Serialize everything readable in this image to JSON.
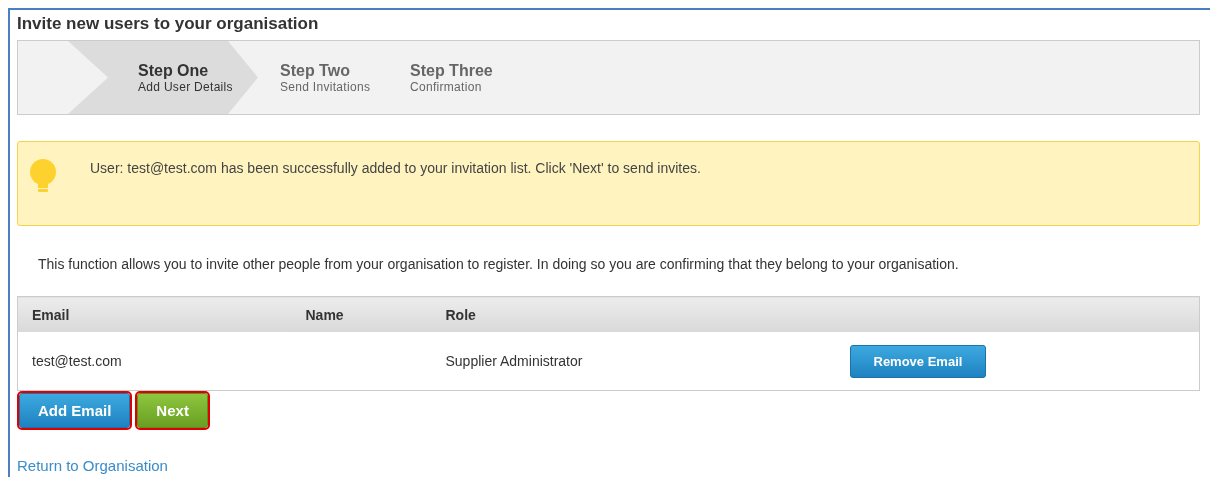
{
  "title": "Invite new users to your organisation",
  "steps": [
    {
      "label": "Step One",
      "caption": "Add User Details",
      "selected": true
    },
    {
      "label": "Step Two",
      "caption": "Send Invitations",
      "selected": false
    },
    {
      "label": "Step Three",
      "caption": "Confirmation",
      "selected": false
    }
  ],
  "alert": {
    "message": "User: test@test.com has been successfully added to your invitation list. Click 'Next' to send invites."
  },
  "intro": "This function allows you to invite other people from your organisation to register. In doing so you are confirming that they belong to your organisation.",
  "table": {
    "columns": [
      "Email",
      "Name",
      "Role"
    ],
    "rows": [
      {
        "email": "test@test.com",
        "name": "",
        "role": "Supplier Administrator",
        "action": "Remove Email"
      }
    ]
  },
  "buttons": [
    {
      "label": "Add Email",
      "kind": "primary",
      "highlighted": true
    },
    {
      "label": "Next",
      "kind": "success",
      "highlighted": true
    }
  ],
  "link": "Return to Organisation"
}
